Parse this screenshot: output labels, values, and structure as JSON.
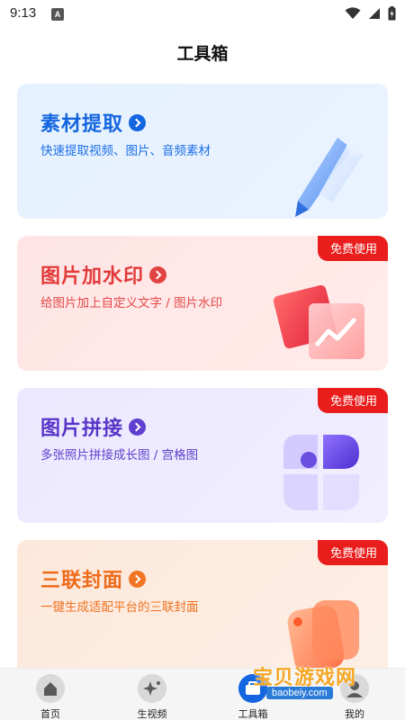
{
  "status": {
    "time": "9:13",
    "notification_letter": "A"
  },
  "page": {
    "title": "工具箱"
  },
  "cards": [
    {
      "title": "素材提取",
      "desc": "快速提取视频、图片、音频素材",
      "badge": "",
      "accent": "#1466e0"
    },
    {
      "title": "图片加水印",
      "desc": "给图片加上自定义文字 / 图片水印",
      "badge": "免费使用",
      "accent": "#e23a3a"
    },
    {
      "title": "图片拼接",
      "desc": "多张照片拼接成长图 / 宫格图",
      "badge": "免费使用",
      "accent": "#5734c8"
    },
    {
      "title": "三联封面",
      "desc": "一键生成适配平台的三联封面",
      "badge": "免费使用",
      "accent": "#ee6b1a"
    }
  ],
  "nav": {
    "items": [
      {
        "label": "首页",
        "icon": "home-icon"
      },
      {
        "label": "生视频",
        "icon": "sparkle-icon"
      },
      {
        "label": "工具箱",
        "icon": "toolbox-icon",
        "active": true
      },
      {
        "label": "我的",
        "icon": "profile-icon"
      }
    ]
  },
  "watermark": {
    "text": "宝贝游戏网",
    "url": "baobeiy.com"
  }
}
